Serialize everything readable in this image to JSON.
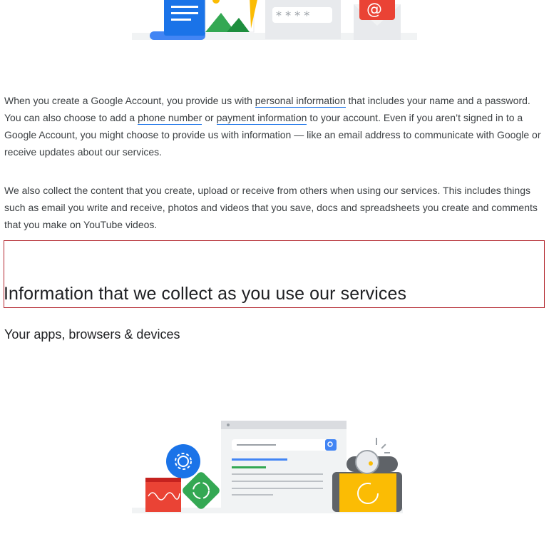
{
  "paragraphs": {
    "p1": {
      "t1": "When you create a Google Account, you provide us with ",
      "link1": "personal information",
      "t2": " that includes your name and a password. You can also choose to add a ",
      "link2": "phone number",
      "t3": " or ",
      "link3": "payment information",
      "t4": " to your account. Even if you aren’t signed in to a Google Account, you might choose to provide us with information — like an email address to communicate with Google or receive updates about our services."
    },
    "p2": "We also collect the content that you create, upload or receive from others when using our services. This includes things such as email you write and receive, photos and videos that you save, docs and spreadsheets you create and comments that you make on YouTube videos."
  },
  "headings": {
    "section_title": "Information that we collect as you use our services",
    "subsection_title": "Your apps, browsers & devices"
  },
  "icons": {
    "top_illustration": [
      "document-icon",
      "photo-icon",
      "password-field-icon",
      "email-envelope-icon"
    ],
    "bottom_illustration": [
      "settings-gear-icon",
      "sync-icon",
      "waveform-icon",
      "browser-window-icon",
      "smartwatch-icon",
      "phone-icon"
    ]
  },
  "colors": {
    "text": "#3c4043",
    "heading": "#202124",
    "link_underline": "#1a73e8",
    "focus_outline": "#b3262e",
    "google_blue": "#4285f4",
    "google_red": "#ea4335",
    "google_yellow": "#fbbc04",
    "google_green": "#34a853"
  }
}
